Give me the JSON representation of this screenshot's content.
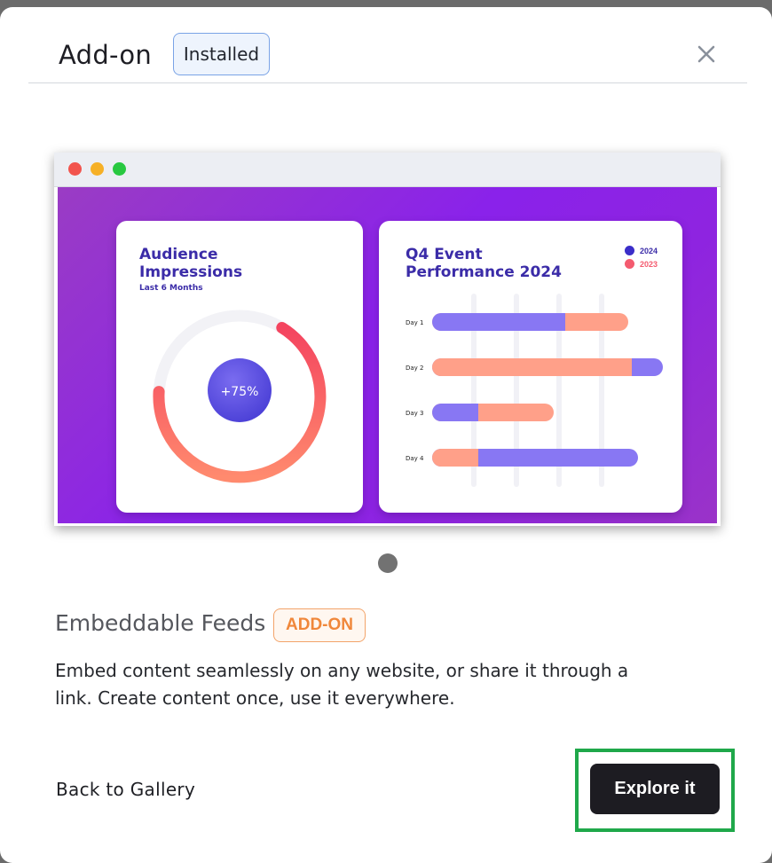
{
  "header": {
    "title": "Add-on",
    "status_badge": "Installed",
    "close_icon": "close-icon"
  },
  "preview": {
    "window_buttons": [
      "#f2544d",
      "#f6b026",
      "#28c840"
    ],
    "audience_card": {
      "title_line1": "Audience",
      "title_line2": "Impressions",
      "subtitle": "Last 6 Months",
      "center_label": "+75%"
    },
    "event_card": {
      "title_line1": "Q4 Event",
      "title_line2": "Performance 2024",
      "legend": [
        {
          "label": "2024",
          "color": "#3b2ec9"
        },
        {
          "label": "2023",
          "color": "#f45b6f"
        }
      ],
      "rows": [
        {
          "label": "Day 1"
        },
        {
          "label": "Day 2"
        },
        {
          "label": "Day 3"
        },
        {
          "label": "Day 4"
        }
      ]
    }
  },
  "feature": {
    "title": "Embeddable Feeds",
    "badge": "ADD-ON",
    "description": "Embed content seamlessly on any website, or share it through a link. Create content once, use it everywhere."
  },
  "footer": {
    "back_label": "Back to Gallery",
    "explore_label": "Explore it"
  },
  "colors": {
    "accent_dark": "#1d1c22",
    "highlight_green": "#1fa84a",
    "badge_orange": "#f0873a",
    "installed_blue": "#7aa3e6"
  }
}
